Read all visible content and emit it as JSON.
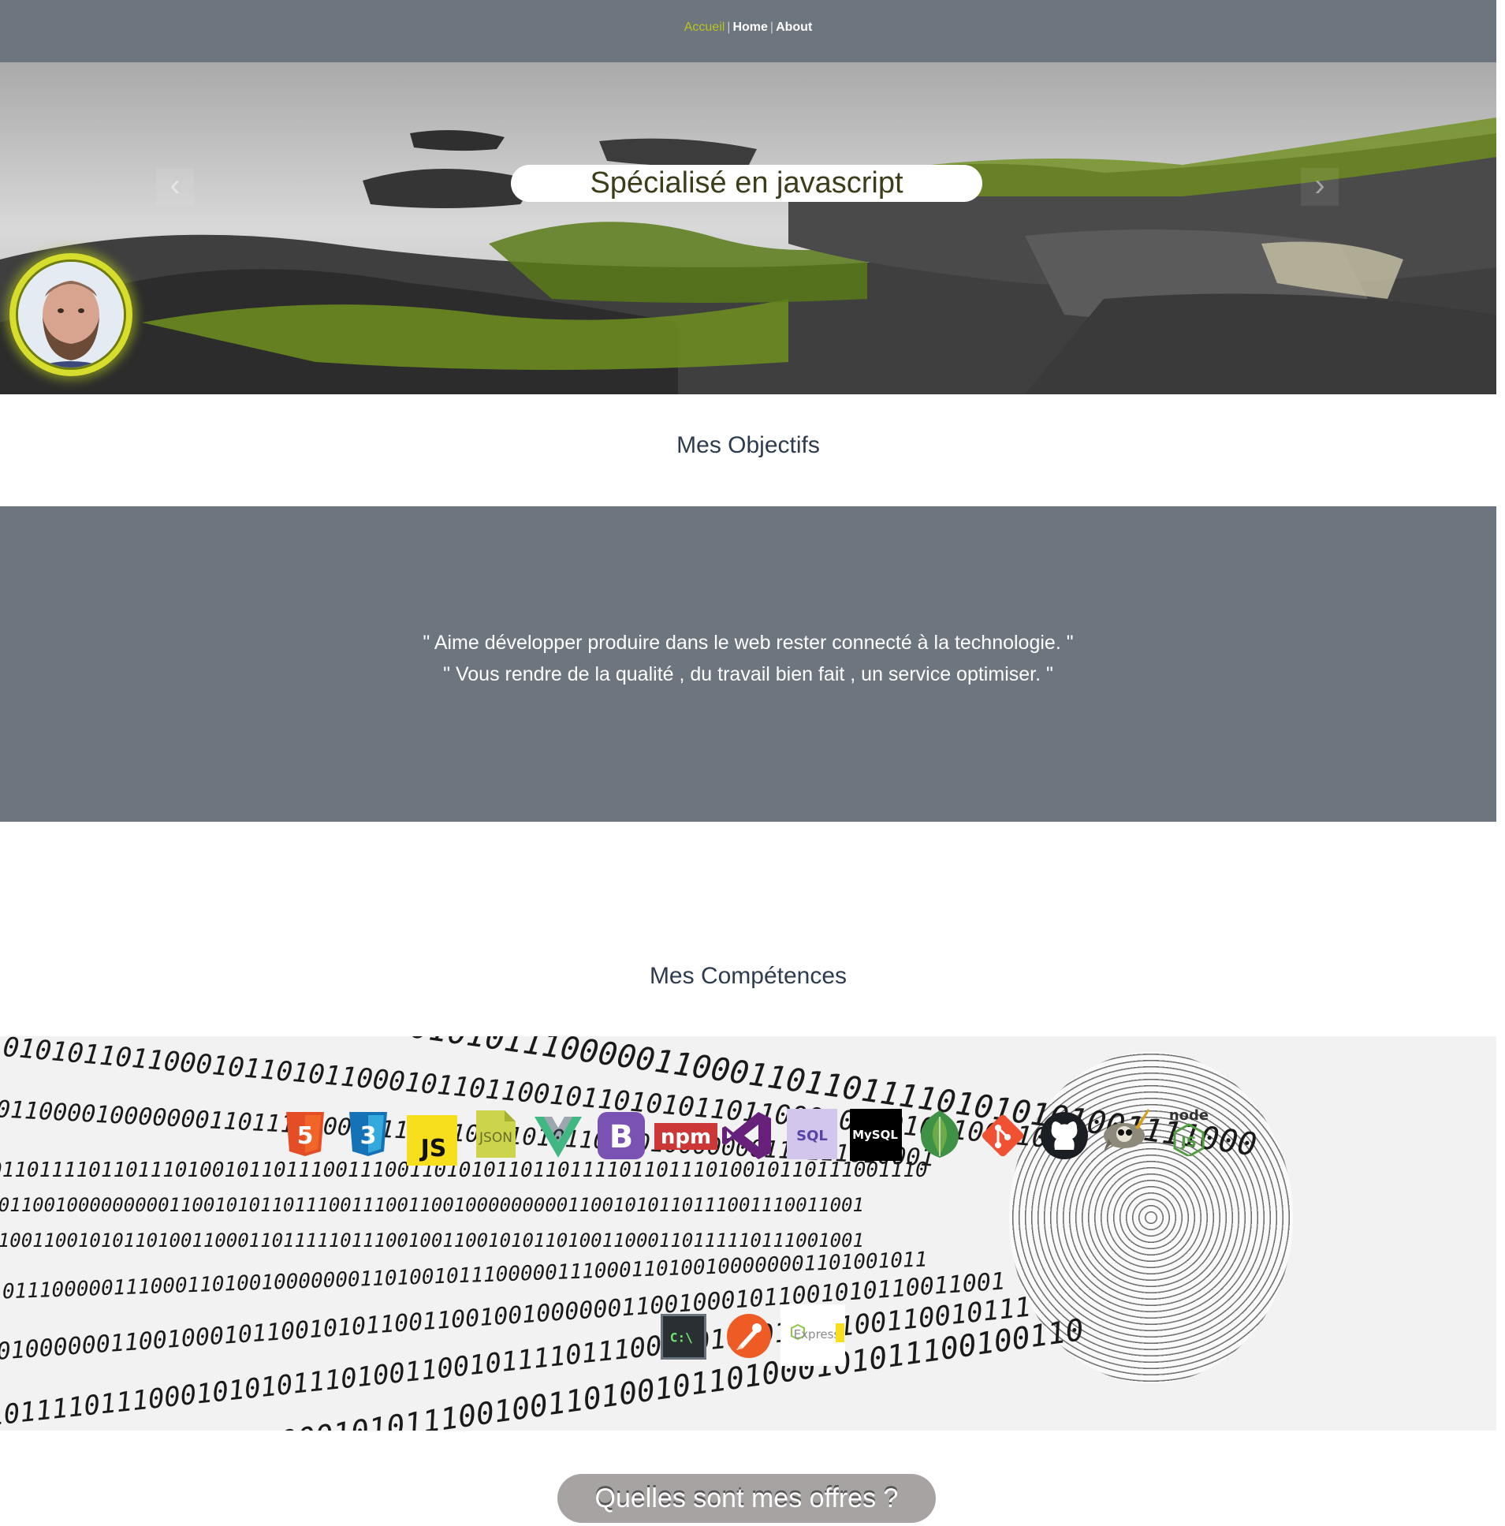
{
  "nav": {
    "items": [
      {
        "label": "Accueil"
      },
      {
        "label": "Home"
      },
      {
        "label": "About"
      }
    ],
    "separator": "|"
  },
  "hero": {
    "caption": "Spécialisé en javascript",
    "prev_glyph": "‹",
    "next_glyph": "›"
  },
  "objectifs": {
    "title": "Mes Objectifs",
    "quote_1": "\" Aime développer produire dans le web rester connecté à la technologie. \"",
    "quote_2": "\" Vous rendre de la qualité , du travail bien fait , un service optimiser. \""
  },
  "competences": {
    "title": "Mes Compétences",
    "icons": [
      {
        "name": "html5-icon",
        "label": "5"
      },
      {
        "name": "css3-icon",
        "label": "3"
      },
      {
        "name": "javascript-icon",
        "label": "JS"
      },
      {
        "name": "json-icon",
        "label": "JSON"
      },
      {
        "name": "vuejs-icon",
        "label": ""
      },
      {
        "name": "bootstrap-icon",
        "label": "B"
      },
      {
        "name": "npm-icon",
        "label": "npm"
      },
      {
        "name": "visual-studio-icon",
        "label": ""
      },
      {
        "name": "sql-icon",
        "label": "SQL"
      },
      {
        "name": "mysql-icon",
        "label": "MySQL"
      },
      {
        "name": "mongodb-icon",
        "label": ""
      },
      {
        "name": "git-icon",
        "label": ""
      },
      {
        "name": "github-icon",
        "label": ""
      },
      {
        "name": "gimp-icon",
        "label": ""
      },
      {
        "name": "nodejs-icon",
        "label": "node JS"
      },
      {
        "name": "terminal-icon",
        "label": "C:\\"
      },
      {
        "name": "postman-icon",
        "label": ""
      },
      {
        "name": "expressjs-icon",
        "label": "Express"
      }
    ]
  },
  "offers": {
    "button_label": "Quelles sont mes offres ?"
  },
  "colors": {
    "nav_bg": "#6d757f",
    "nav_active": "#b9c31f",
    "title_color": "#2e3b4e",
    "offers_bg": "#a7a3a3"
  }
}
